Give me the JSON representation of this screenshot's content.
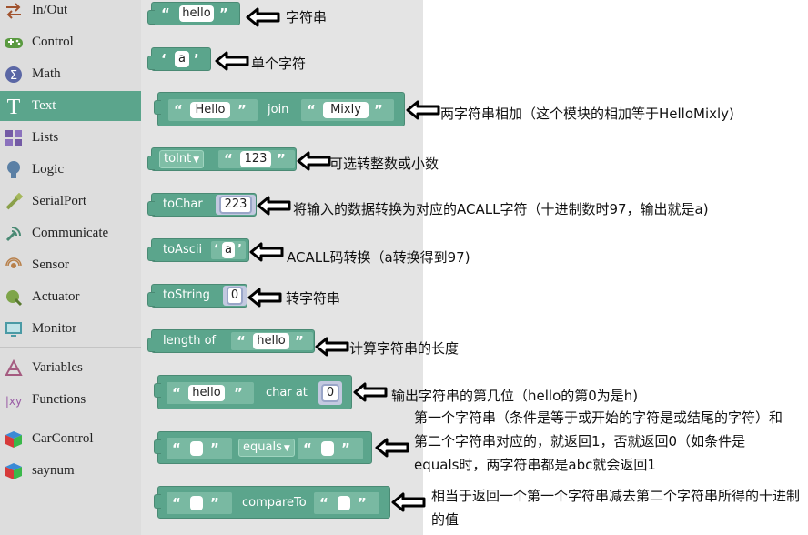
{
  "sidebar": {
    "categories": [
      {
        "label": "In/Out",
        "icon": "arrows-icon"
      },
      {
        "label": "Control",
        "icon": "gamepad-icon"
      },
      {
        "label": "Math",
        "icon": "sigma-icon"
      },
      {
        "label": "Text",
        "icon": "text-t-icon"
      },
      {
        "label": "Lists",
        "icon": "list-blocks-icon"
      },
      {
        "label": "Logic",
        "icon": "bulb-icon"
      },
      {
        "label": "SerialPort",
        "icon": "usb-plug-icon"
      },
      {
        "label": "Communicate",
        "icon": "signal-icon"
      },
      {
        "label": "Sensor",
        "icon": "sensor-icon"
      },
      {
        "label": "Actuator",
        "icon": "actuator-icon"
      },
      {
        "label": "Monitor",
        "icon": "monitor-icon"
      },
      {
        "label": "Variables",
        "icon": "variables-icon"
      },
      {
        "label": "Functions",
        "icon": "functions-icon"
      },
      {
        "label": "CarControl",
        "icon": "cube-icon"
      },
      {
        "label": "saynum",
        "icon": "cube-icon"
      }
    ],
    "selected": "Text"
  },
  "blocks": {
    "string": {
      "value": "hello"
    },
    "char": {
      "value": "a"
    },
    "join": {
      "left": "Hello",
      "op": "join",
      "right": "Mixly"
    },
    "toint": {
      "label": "toInt",
      "value": "123"
    },
    "tochar": {
      "label": "toChar",
      "value": "223"
    },
    "toascii": {
      "label": "toAscii",
      "value": "a"
    },
    "tostring": {
      "label": "toString",
      "value": "0"
    },
    "length": {
      "label": "length of",
      "value": "hello"
    },
    "charat": {
      "text": "hello",
      "op": "char at",
      "index": "0"
    },
    "equals": {
      "op": "equals"
    },
    "compare": {
      "op": "compareTo"
    }
  },
  "annotations": [
    "字符串",
    "单个字符",
    "两字符串相加（这个模块的相加等于HelloMixly)",
    "可选转整数或小数",
    "将输入的数据转换为对应的ACALL字符（十进制数时97，输出就是a)",
    "ACALL码转换（a转换得到97)",
    "转字符串",
    "计算字符串的长度",
    "输出字符串的第几位（hello的第0为是h)",
    "第一个字符串（条件是等于或开始的字符是或结尾的字符）和第二个字符串对应的，就返回1，否就返回0（如条件是equals时，两字符串都是abc就会返回1",
    "相当于返回一个第一个字符串减去第二个字符串所得的十进制的值"
  ],
  "colors": {
    "block": "#5ba58c",
    "selected_category": "#5ba58c",
    "sidebar": "#dddddd",
    "workspace": "#e4e4e4"
  }
}
